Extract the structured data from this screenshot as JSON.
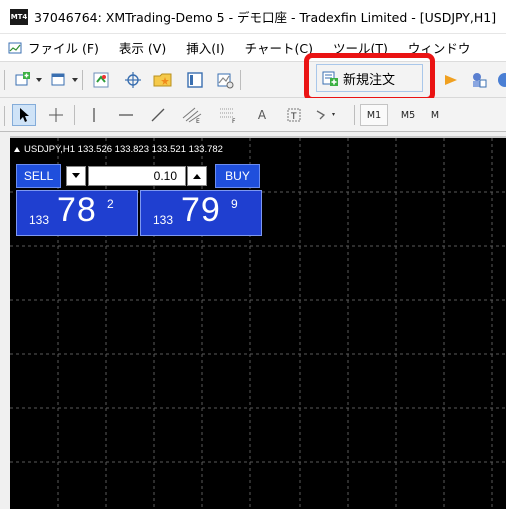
{
  "window": {
    "title": "37046764: XMTrading-Demo 5 - デモ口座 - Tradexfin Limited - [USDJPY,H1]",
    "app_icon": "MT4"
  },
  "menu": [
    {
      "label": "ファイル (F)",
      "icon": "chart-icon"
    },
    {
      "label": "表示 (V)"
    },
    {
      "label": "挿入(I)"
    },
    {
      "label": "チャート(C)"
    },
    {
      "label": "ツール(T)"
    },
    {
      "label": "ウィンドウ"
    }
  ],
  "toolbar": {
    "new_order_label": "新規注文",
    "highlight_color": "#ea1313"
  },
  "toolbar2": {
    "text_tool": "A",
    "timeframes": [
      "M1",
      "M5",
      "M"
    ]
  },
  "chart": {
    "header": "USDJPY,H1  133.526 133.823 133.521 133.782",
    "grid_color": "#5a5a5a",
    "background": "#000000"
  },
  "one_click": {
    "sell_label": "SELL",
    "buy_label": "BUY",
    "lot_value": "0.10",
    "sell_price": {
      "big": "133",
      "main": "78",
      "sup": "2"
    },
    "buy_price": {
      "big": "133",
      "main": "79",
      "sup": "9"
    },
    "button_color": "#1f4fdc"
  }
}
